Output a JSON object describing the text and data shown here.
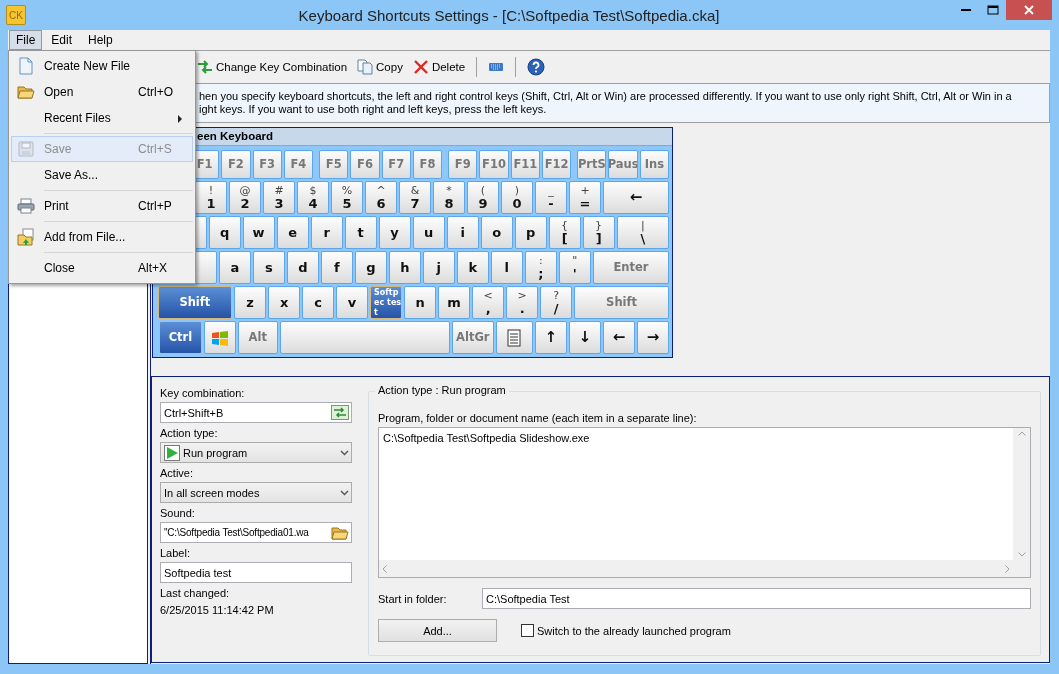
{
  "window": {
    "icon_label": "CK",
    "title": "Keyboard Shortcuts Settings - [C:\\Softpedia Test\\Softpedia.cka]"
  },
  "menubar": [
    {
      "label": "File",
      "selected": true
    },
    {
      "label": "Edit",
      "selected": false
    },
    {
      "label": "Help",
      "selected": false
    }
  ],
  "file_menu": [
    {
      "kind": "item",
      "label": "Create New File",
      "selected": false,
      "disabled": false,
      "submenu": false
    },
    {
      "kind": "item",
      "label": "Open",
      "shortcut": "Ctrl+O",
      "selected": false,
      "disabled": false,
      "submenu": false
    },
    {
      "kind": "item",
      "label": "Recent Files",
      "selected": false,
      "disabled": false,
      "submenu": true
    },
    {
      "kind": "separator"
    },
    {
      "kind": "item",
      "label": "Save",
      "shortcut": "Ctrl+S",
      "selected": true,
      "disabled": true,
      "submenu": false
    },
    {
      "kind": "item",
      "label": "Save As...",
      "selected": false,
      "disabled": false,
      "submenu": false
    },
    {
      "kind": "separator"
    },
    {
      "kind": "item",
      "label": "Print",
      "shortcut": "Ctrl+P",
      "selected": false,
      "disabled": false,
      "submenu": false
    },
    {
      "kind": "separator"
    },
    {
      "kind": "item",
      "label": "Add from File...",
      "selected": false,
      "disabled": false,
      "submenu": false
    },
    {
      "kind": "separator"
    },
    {
      "kind": "item",
      "label": "Close",
      "shortcut": "Alt+X",
      "selected": false,
      "disabled": false,
      "submenu": false
    }
  ],
  "toolbar": [
    {
      "kind": "button",
      "label": "Change Key Combination"
    },
    {
      "kind": "button",
      "label": "Copy"
    },
    {
      "kind": "button",
      "label": "Delete"
    },
    {
      "kind": "separator"
    },
    {
      "kind": "icon-button"
    },
    {
      "kind": "separator"
    },
    {
      "kind": "icon-button"
    }
  ],
  "info": {
    "lines": [
      "hen you specify keyboard shortcuts, the left and right control keys (Shift, Ctrl, Alt or Win) are processed differently. If you want to use only right Shift, Ctrl, Alt or Win in a",
      "ight keys. If you want to use both right and left keys, press the left keys."
    ]
  },
  "keyboard": {
    "title": "een Keyboard",
    "rows": [
      {
        "keys": [
          {
            "kind": "fn",
            "label": "F1",
            "pressed": false,
            "assigned": false
          },
          {
            "kind": "fn",
            "label": "F2",
            "pressed": false,
            "assigned": false
          },
          {
            "kind": "fn",
            "label": "F3",
            "pressed": false,
            "assigned": false
          },
          {
            "kind": "fn",
            "label": "F4",
            "pressed": false,
            "assigned": false
          },
          {
            "kind": "fn",
            "label": "F5",
            "pressed": false,
            "assigned": false
          },
          {
            "kind": "fn",
            "label": "F6",
            "pressed": false,
            "assigned": false
          },
          {
            "kind": "fn",
            "label": "F7",
            "pressed": false,
            "assigned": false
          },
          {
            "kind": "fn",
            "label": "F8",
            "pressed": false,
            "assigned": false
          },
          {
            "kind": "fn",
            "label": "F9",
            "pressed": false,
            "assigned": false
          },
          {
            "kind": "fn",
            "label": "F10",
            "pressed": false,
            "assigned": false
          },
          {
            "kind": "fn",
            "label": "F11",
            "pressed": false,
            "assigned": false
          },
          {
            "kind": "fn",
            "label": "F12",
            "pressed": false,
            "assigned": false
          },
          {
            "kind": "fn",
            "label": "PrtS",
            "pressed": false,
            "assigned": false
          },
          {
            "kind": "fn",
            "label": "Paus",
            "pressed": false,
            "assigned": false
          },
          {
            "kind": "fn",
            "label": "Ins",
            "pressed": false,
            "assigned": false
          }
        ]
      },
      {
        "keys": [
          {
            "kind": "key",
            "top": "!",
            "label": "1",
            "pressed": false,
            "assigned": false
          },
          {
            "kind": "key",
            "top": "@",
            "label": "2",
            "pressed": false,
            "assigned": false
          },
          {
            "kind": "key",
            "top": "#",
            "label": "3",
            "pressed": false,
            "assigned": false
          },
          {
            "kind": "key",
            "top": "$",
            "label": "4",
            "pressed": false,
            "assigned": false
          },
          {
            "kind": "key",
            "top": "%",
            "label": "5",
            "pressed": false,
            "assigned": false
          },
          {
            "kind": "key",
            "top": "^",
            "label": "6",
            "pressed": false,
            "assigned": false
          },
          {
            "kind": "key",
            "top": "&",
            "label": "7",
            "pressed": false,
            "assigned": false
          },
          {
            "kind": "key",
            "top": "*",
            "label": "8",
            "pressed": false,
            "assigned": false
          },
          {
            "kind": "key",
            "top": "(",
            "label": "9",
            "pressed": false,
            "assigned": false
          },
          {
            "kind": "key",
            "top": ")",
            "label": "0",
            "pressed": false,
            "assigned": false
          },
          {
            "kind": "key",
            "top": "_",
            "label": "-",
            "pressed": false,
            "assigned": false
          },
          {
            "kind": "key",
            "top": "+",
            "label": "=",
            "pressed": false,
            "assigned": false
          },
          {
            "kind": "backspace",
            "label": "←",
            "pressed": false,
            "assigned": false
          }
        ]
      },
      {
        "keys": [
          {
            "kind": "tab",
            "pressed": false,
            "assigned": false
          },
          {
            "kind": "key",
            "label": "q",
            "pressed": false,
            "assigned": false
          },
          {
            "kind": "key",
            "label": "w",
            "pressed": false,
            "assigned": false
          },
          {
            "kind": "key",
            "label": "e",
            "pressed": false,
            "assigned": false
          },
          {
            "kind": "key",
            "label": "r",
            "pressed": false,
            "assigned": false
          },
          {
            "kind": "key",
            "label": "t",
            "pressed": false,
            "assigned": false
          },
          {
            "kind": "key",
            "label": "y",
            "pressed": false,
            "assigned": false
          },
          {
            "kind": "key",
            "label": "u",
            "pressed": false,
            "assigned": false
          },
          {
            "kind": "key",
            "label": "i",
            "pressed": false,
            "assigned": false
          },
          {
            "kind": "key",
            "label": "o",
            "pressed": false,
            "assigned": false
          },
          {
            "kind": "key",
            "label": "p",
            "pressed": false,
            "assigned": false
          },
          {
            "kind": "key",
            "top": "{",
            "label": "[",
            "pressed": false,
            "assigned": false
          },
          {
            "kind": "key",
            "top": "}",
            "label": "]",
            "pressed": false,
            "assigned": false
          },
          {
            "kind": "wide",
            "top": "|",
            "label": "\\",
            "pressed": false,
            "assigned": false
          }
        ]
      },
      {
        "keys": [
          {
            "kind": "caps",
            "pressed": false,
            "assigned": false
          },
          {
            "kind": "key",
            "label": "a",
            "pressed": false,
            "assigned": false
          },
          {
            "kind": "key",
            "label": "s",
            "pressed": false,
            "assigned": false
          },
          {
            "kind": "key",
            "label": "d",
            "pressed": false,
            "assigned": false
          },
          {
            "kind": "key",
            "label": "f",
            "pressed": false,
            "assigned": false
          },
          {
            "kind": "key",
            "label": "g",
            "pressed": false,
            "assigned": false
          },
          {
            "kind": "key",
            "label": "h",
            "pressed": false,
            "assigned": false
          },
          {
            "kind": "key",
            "label": "j",
            "pressed": false,
            "assigned": false
          },
          {
            "kind": "key",
            "label": "k",
            "pressed": false,
            "assigned": false
          },
          {
            "kind": "key",
            "label": "l",
            "pressed": false,
            "assigned": false
          },
          {
            "kind": "key",
            "top": ":",
            "label": ";",
            "pressed": false,
            "assigned": false
          },
          {
            "kind": "key",
            "top": "\"",
            "label": "'",
            "pressed": false,
            "assigned": false
          },
          {
            "kind": "enter",
            "label": "Enter",
            "pressed": false,
            "assigned": false
          }
        ]
      },
      {
        "keys": [
          {
            "kind": "shift",
            "label": "Shift",
            "pressed": true,
            "assigned": false
          },
          {
            "kind": "key",
            "label": "z",
            "pressed": false,
            "assigned": false
          },
          {
            "kind": "key",
            "label": "x",
            "pressed": false,
            "assigned": false
          },
          {
            "kind": "key",
            "label": "c",
            "pressed": false,
            "assigned": false
          },
          {
            "kind": "key",
            "label": "v",
            "pressed": false,
            "assigned": false
          },
          {
            "kind": "key",
            "label": "Softpec test",
            "pressed": false,
            "assigned": true
          },
          {
            "kind": "key",
            "label": "n",
            "pressed": false,
            "assigned": false
          },
          {
            "kind": "key",
            "label": "m",
            "pressed": false,
            "assigned": false
          },
          {
            "kind": "key",
            "top": "<",
            "label": ",",
            "pressed": false,
            "assigned": false
          },
          {
            "kind": "key",
            "top": ">",
            "label": ".",
            "pressed": false,
            "assigned": false
          },
          {
            "kind": "key",
            "top": "?",
            "label": "/",
            "pressed": false,
            "assigned": false
          },
          {
            "kind": "rshift",
            "label": "Shift",
            "pressed": false,
            "assigned": false
          }
        ]
      },
      {
        "keys": [
          {
            "kind": "ctrl",
            "label": "Ctrl",
            "pressed": true,
            "assigned": false
          },
          {
            "kind": "win",
            "pressed": false,
            "assigned": false
          },
          {
            "kind": "alt",
            "label": "Alt",
            "pressed": false,
            "assigned": false
          },
          {
            "kind": "space",
            "pressed": false,
            "assigned": false
          },
          {
            "kind": "altgr",
            "label": "AltGr",
            "pressed": false,
            "assigned": false
          },
          {
            "kind": "menu",
            "pressed": false,
            "assigned": false
          },
          {
            "kind": "arrow",
            "label": "↑",
            "pressed": false,
            "assigned": false
          },
          {
            "kind": "arrow",
            "label": "↓",
            "pressed": false,
            "assigned": false
          },
          {
            "kind": "arrow",
            "label": "←",
            "pressed": false,
            "assigned": false
          },
          {
            "kind": "arrow",
            "label": "→",
            "pressed": false,
            "assigned": false
          }
        ]
      }
    ]
  },
  "details": [
    {
      "kind": "field-with-button",
      "label": "Key combination:",
      "value": "Ctrl+Shift+B"
    },
    {
      "kind": "select-with-icon",
      "label": "Action type:",
      "value": "Run program"
    },
    {
      "kind": "select",
      "label": "Active:",
      "value": "In all screen modes"
    },
    {
      "kind": "browse-field",
      "label": "Sound:",
      "value": "\"C:\\Softpedia Test\\Softpedia01.wa"
    },
    {
      "kind": "text",
      "label": "Label:",
      "value": "Softpedia test"
    },
    {
      "kind": "readout",
      "label": "Last changed:",
      "value": "6/25/2015 11:14:42 PM"
    }
  ],
  "action": {
    "title": "Action type : Run program",
    "program_label": "Program, folder or document name (each item in a separate line):",
    "program_value": "C:\\Softpedia Test\\Softpedia Slideshow.exe",
    "start_label": "Start in folder:",
    "start_value": "C:\\Softpedia Test",
    "add_button": "Add...",
    "switch_checkbox": {
      "label": "Switch to the already launched program",
      "checked": false
    }
  }
}
